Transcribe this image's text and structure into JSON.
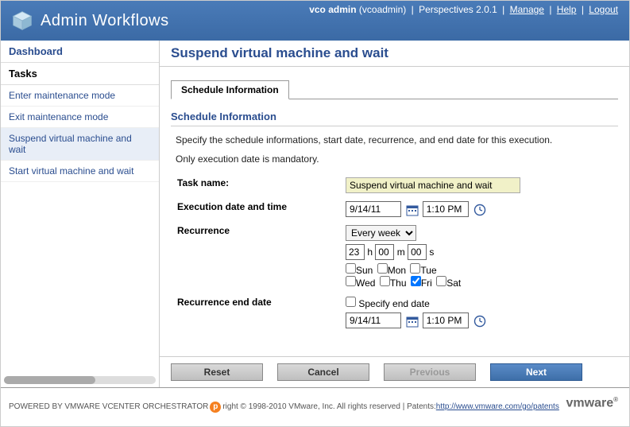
{
  "header": {
    "title": "Admin Workflows",
    "user_bold": "vco admin",
    "user_paren": "(vcoadmin)",
    "perspectives": "Perspectives 2.0.1",
    "manage": "Manage",
    "help": "Help",
    "logout": "Logout"
  },
  "sidebar": {
    "dashboard": "Dashboard",
    "tasks_label": "Tasks",
    "items": [
      {
        "label": "Enter maintenance mode"
      },
      {
        "label": "Exit maintenance mode"
      },
      {
        "label": "Suspend virtual machine and wait"
      },
      {
        "label": "Start virtual machine and wait"
      }
    ]
  },
  "page": {
    "title": "Suspend virtual machine and wait",
    "tab": "Schedule Information",
    "section_heading": "Schedule Information",
    "help1": "Specify the schedule informations, start date, recurrence, and end date for this execution.",
    "help2": "Only execution date is mandatory.",
    "labels": {
      "task_name": "Task name:",
      "exec_datetime": "Execution date and time",
      "recurrence": "Recurrence",
      "recurrence_end": "Recurrence end date",
      "specify_end": "Specify end date"
    },
    "values": {
      "task_name": "Suspend virtual machine and wait",
      "exec_date": "9/14/11",
      "exec_time": "1:10 PM",
      "recurrence_select": "Every week",
      "hours": "23",
      "minutes": "00",
      "seconds": "00",
      "h_unit": "h",
      "m_unit": "m",
      "s_unit": "s",
      "end_date": "9/14/11",
      "end_time": "1:10 PM"
    },
    "days": {
      "sun": "Sun",
      "mon": "Mon",
      "tue": "Tue",
      "wed": "Wed",
      "thu": "Thu",
      "fri": "Fri",
      "sat": "Sat",
      "fri_checked": true
    }
  },
  "buttons": {
    "reset": "Reset",
    "cancel": "Cancel",
    "previous": "Previous",
    "next": "Next"
  },
  "footer": {
    "powered": "POWERED BY VMWARE VCENTER ORCHESTRATOR",
    "copyright": "right © 1998-2010 VMware, Inc. All rights reserved | Patents: ",
    "patents_url": "http://www.vmware.com/go/patents",
    "vmware": "vmware"
  }
}
